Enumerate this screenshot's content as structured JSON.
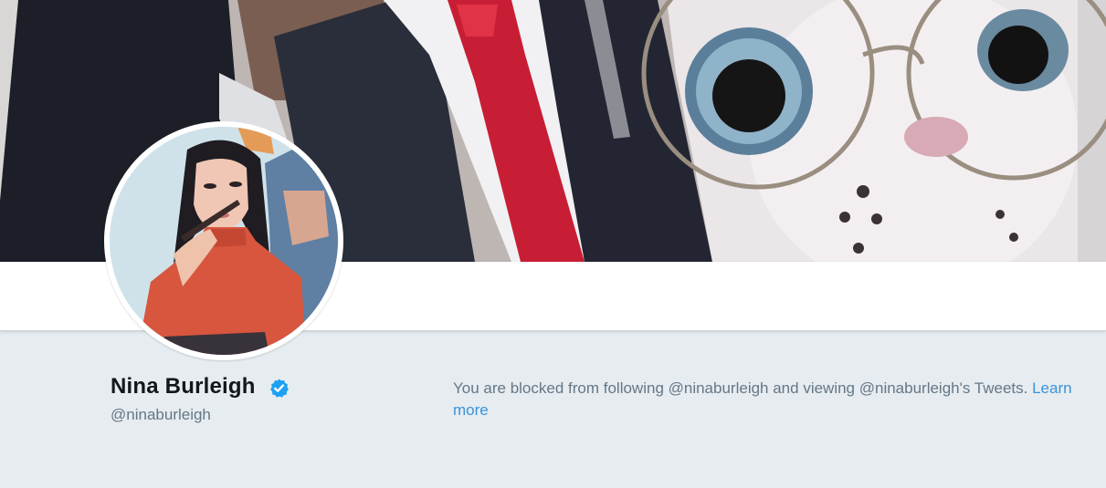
{
  "profile": {
    "name": "Nina Burleigh",
    "handle": "@ninaburleigh",
    "verified": true,
    "verified_icon": "verified-badge-icon"
  },
  "blocked_notice": {
    "text": "You are blocked from following @ninaburleigh and viewing @ninaburleigh's Tweets.",
    "link_text": "Learn more"
  },
  "colors": {
    "background": "#e6ecf0",
    "link": "#3b94d9",
    "verified": "#1da1f2",
    "name": "#14171a",
    "secondary_text": "#657786"
  }
}
